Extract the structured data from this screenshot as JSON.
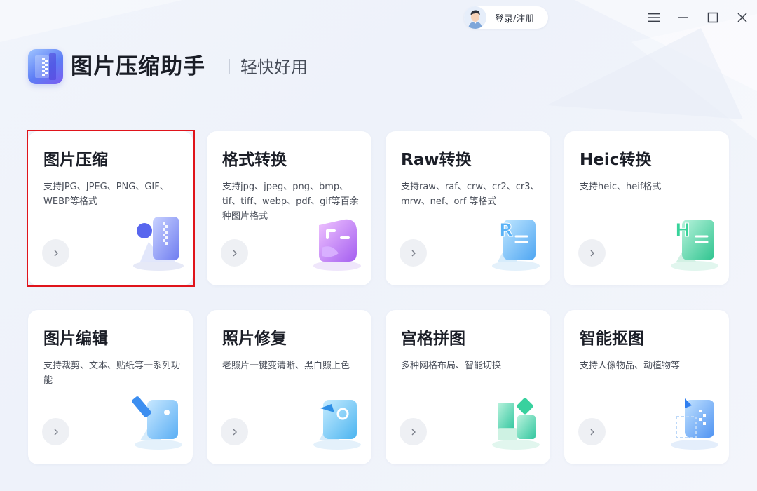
{
  "titlebar": {
    "login_label": "登录/注册",
    "icons": [
      "avatar",
      "menu-icon",
      "minimize-icon",
      "maximize-icon",
      "close-icon"
    ]
  },
  "header": {
    "title": "图片压缩助手",
    "slogan": "轻快好用"
  },
  "cards": [
    {
      "title": "图片压缩",
      "desc": "支持JPG、JPEG、PNG、GIF、WEBP等格式",
      "icon": "compress-image-icon",
      "selected": true
    },
    {
      "title": "格式转换",
      "desc": "支持jpg、jpeg、png、bmp、tif、tiff、webp、pdf、gif等百余种图片格式",
      "icon": "format-convert-icon",
      "selected": false
    },
    {
      "title": "Raw转换",
      "desc": "支持raw、raf、crw、cr2、cr3、mrw、nef、orf 等格式",
      "icon": "raw-convert-icon",
      "selected": false
    },
    {
      "title": "Heic转换",
      "desc": "支持heic、heif格式",
      "icon": "heic-convert-icon",
      "selected": false
    },
    {
      "title": "图片编辑",
      "desc": "支持裁剪、文本、贴纸等一系列功能",
      "icon": "image-edit-icon",
      "selected": false
    },
    {
      "title": "照片修复",
      "desc": "老照片一键变清晰、黑白照上色",
      "icon": "photo-repair-icon",
      "selected": false
    },
    {
      "title": "宫格拼图",
      "desc": "多种网格布局、智能切换",
      "icon": "grid-collage-icon",
      "selected": false
    },
    {
      "title": "智能抠图",
      "desc": "支持人像物品、动植物等",
      "icon": "smart-cutout-icon",
      "selected": false
    }
  ],
  "colors": {
    "selection_outline": "#e0141b",
    "background": "#f1f4fb",
    "card": "#ffffff",
    "arrow_button": "#eef0f4"
  }
}
